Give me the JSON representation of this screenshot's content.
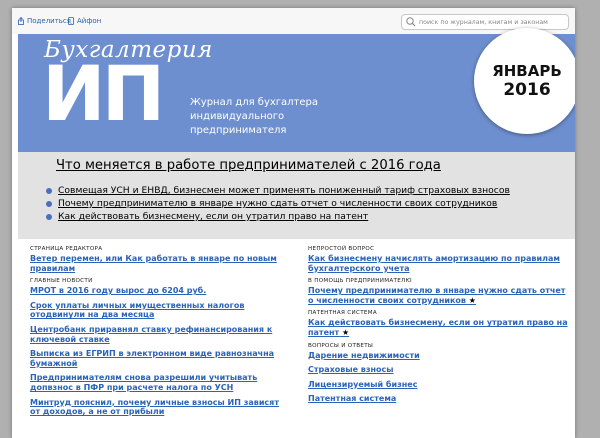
{
  "toolbar": {
    "share_label": "Поделиться",
    "iphone_label": "Айфон",
    "search_placeholder": "поиск по журналам, книгам и законам"
  },
  "banner": {
    "logo_top": "Бухгалтерия",
    "logo_big": "ИП",
    "tagline_lines": [
      "Журнал для бухгалтера",
      "индивидуального",
      "предпринимателя"
    ],
    "issue_month": "ЯНВАРЬ",
    "issue_year": "2016",
    "color": "#6e8fcf"
  },
  "cover": {
    "headline": "Что меняется в работе предпринимателей с 2016 года",
    "items": [
      "Совмещая УСН и ЕНВД, бизнесмен может применять пониженный тариф страховых взносов",
      "Почему предпринимателю в январе нужно сдать отчет о численности своих сотрудников",
      "Как действовать бизнесмену, если он утратил право на патент"
    ]
  },
  "toc_left": [
    {
      "title": "СТРАНИЦА РЕДАКТОРА",
      "articles": [
        {
          "text": "Ветер перемен, или Как работать в январе по новым правилам",
          "star": false
        }
      ]
    },
    {
      "title": "ГЛАВНЫЕ НОВОСТИ",
      "articles": [
        {
          "text": "МРОТ в 2016 году вырос до 6204 руб.",
          "star": false
        },
        {
          "text": "Срок уплаты личных имущественных налогов отодвинули на два месяца",
          "star": false
        },
        {
          "text": "Центробанк приравнял ставку рефинансирования к ключевой ставке",
          "star": false
        },
        {
          "text": "Выписка из ЕГРИП в электронном виде равнозначна бумажной",
          "star": false
        },
        {
          "text": "Предпринимателям снова разрешили учитывать допвзнос в ПФР при расчете налога по УСН",
          "star": false
        },
        {
          "text": "Минтруд пояснил, почему личные взносы ИП зависят от доходов, а не от прибыли",
          "star": false
        }
      ]
    }
  ],
  "toc_right": [
    {
      "title": "НЕПРОСТОЙ ВОПРОС",
      "articles": [
        {
          "text": "Как бизнесмену начислять амортизацию по правилам бухгалтерского учета",
          "star": false
        }
      ]
    },
    {
      "title": "В ПОМОЩЬ ПРЕДПРИНИМАТЕЛЮ",
      "articles": [
        {
          "text": "Почему предпринимателю в январе нужно сдать отчет о численности своих сотрудников",
          "star": true
        }
      ]
    },
    {
      "title": "ПАТЕНТНАЯ СИСТЕМА",
      "articles": [
        {
          "text": "Как действовать бизнесмену, если он утратил право на патент",
          "star": true
        }
      ]
    },
    {
      "title": "ВОПРОСЫ И ОТВЕТЫ",
      "articles": [
        {
          "text": "Дарение недвижимости",
          "star": false
        },
        {
          "text": "Страховые взносы",
          "star": false
        },
        {
          "text": "Лицензируемый бизнес",
          "star": false
        },
        {
          "text": "Патентная система",
          "star": false
        }
      ]
    }
  ],
  "star_symbol": "★"
}
